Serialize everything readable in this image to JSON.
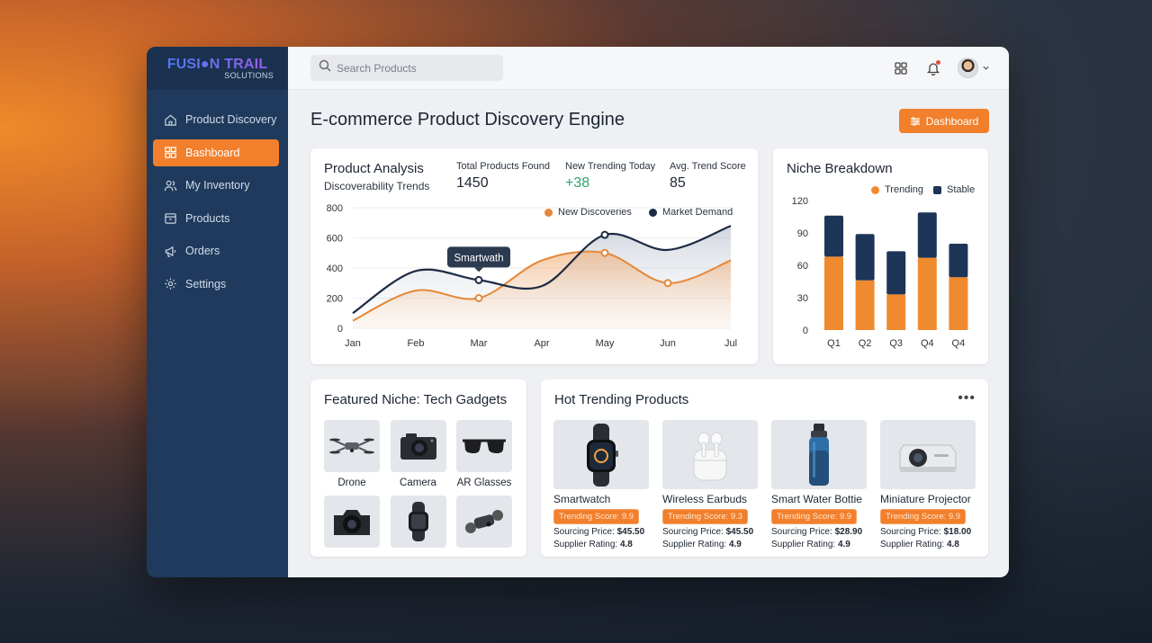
{
  "brand": {
    "name": "FUSI●N TRAIL",
    "sub": "SOLUTIONS"
  },
  "sidebar": {
    "items": [
      {
        "label": "Product Discovery",
        "icon": "home-icon",
        "active": false
      },
      {
        "label": "Bashboard",
        "icon": "grid-icon",
        "active": true
      },
      {
        "label": "My Inventory",
        "icon": "users-icon",
        "active": false
      },
      {
        "label": "Products",
        "icon": "box-icon",
        "active": false
      },
      {
        "label": "Orders",
        "icon": "megaphone-icon",
        "active": false
      },
      {
        "label": "Settings",
        "icon": "gear-icon",
        "active": false
      }
    ]
  },
  "topbar": {
    "search_placeholder": "Search Products"
  },
  "page": {
    "title": "E-commerce Product Discovery Engine",
    "action_button": "Dashboard"
  },
  "analysis": {
    "title": "Product Analysis",
    "subtitle": "Discoverability Trends",
    "stats": [
      {
        "label": "Total Products Found",
        "value": "1450"
      },
      {
        "label": "New Trending Today",
        "value": "+38"
      },
      {
        "label": "Avg. Trend Score",
        "value": "85"
      }
    ],
    "tooltip": "Smartwath"
  },
  "niche": {
    "title": "Niche Breakdown"
  },
  "colors": {
    "accent": "#f27f2c",
    "navy": "#1d3557",
    "sidebar": "#1f3a5c"
  },
  "chart_data": [
    {
      "type": "line",
      "x": [
        "Jan",
        "Feb",
        "Mar",
        "Apr",
        "May",
        "Jun",
        "Jul"
      ],
      "ylim": [
        0,
        800
      ],
      "yticks": [
        "0",
        "200",
        "400",
        "600",
        "800"
      ],
      "legend_placement": "top-right",
      "series": [
        {
          "name": "New Discoveries",
          "color": "#e5883a",
          "values": [
            50,
            250,
            200,
            450,
            500,
            300,
            450
          ]
        },
        {
          "name": "Market Demand",
          "color": "#1d2b44",
          "values": [
            100,
            380,
            320,
            280,
            620,
            520,
            680
          ]
        }
      ]
    },
    {
      "type": "bar",
      "stacked": true,
      "categories": [
        "Q1",
        "Q2",
        "Q3",
        "Q4",
        "Q4"
      ],
      "ylim": [
        0,
        120
      ],
      "yticks": [
        "0",
        "30",
        "60",
        "90",
        "120"
      ],
      "legend_placement": "top-right",
      "series": [
        {
          "name": "Trending",
          "color": "#f08a2f",
          "values": [
            68,
            46,
            33,
            67,
            49
          ]
        },
        {
          "name": "Stable",
          "color": "#1d3557",
          "values": [
            38,
            43,
            40,
            42,
            31
          ]
        }
      ]
    }
  ],
  "featured": {
    "title": "Featured Niche: Tech Gadgets",
    "items": [
      {
        "label": "Drone",
        "icon": "drone-icon"
      },
      {
        "label": "Camera",
        "icon": "camera-icon"
      },
      {
        "label": "AR Glasses",
        "icon": "glasses-icon"
      },
      {
        "label": "",
        "icon": "dslr-icon"
      },
      {
        "label": "",
        "icon": "smartwatch-icon"
      },
      {
        "label": "",
        "icon": "mini-drone-icon"
      }
    ]
  },
  "hot": {
    "title": "Hot Trending Products",
    "more": "•••",
    "price_label": "Sourcing Price:",
    "rating_label": "Supplier Rating:",
    "products": [
      {
        "name": "Smartwatch",
        "score": "Trending Score: 9.9",
        "price": "$45.50",
        "rating": "4.8",
        "icon": "smartwatch-icon"
      },
      {
        "name": "Wireless Earbuds",
        "score": "Trending Score: 9.3",
        "price": "$45.50",
        "rating": "4.9",
        "icon": "earbuds-icon"
      },
      {
        "name": "Smart Water Bottie",
        "score": "Trending Score: 9.9",
        "price": "$28.90",
        "rating": "4.9",
        "icon": "bottle-icon"
      },
      {
        "name": "Miniature Projector",
        "score": "Trending Score: 9.9",
        "price": "$18.00",
        "rating": "4.8",
        "icon": "projector-icon"
      }
    ]
  }
}
